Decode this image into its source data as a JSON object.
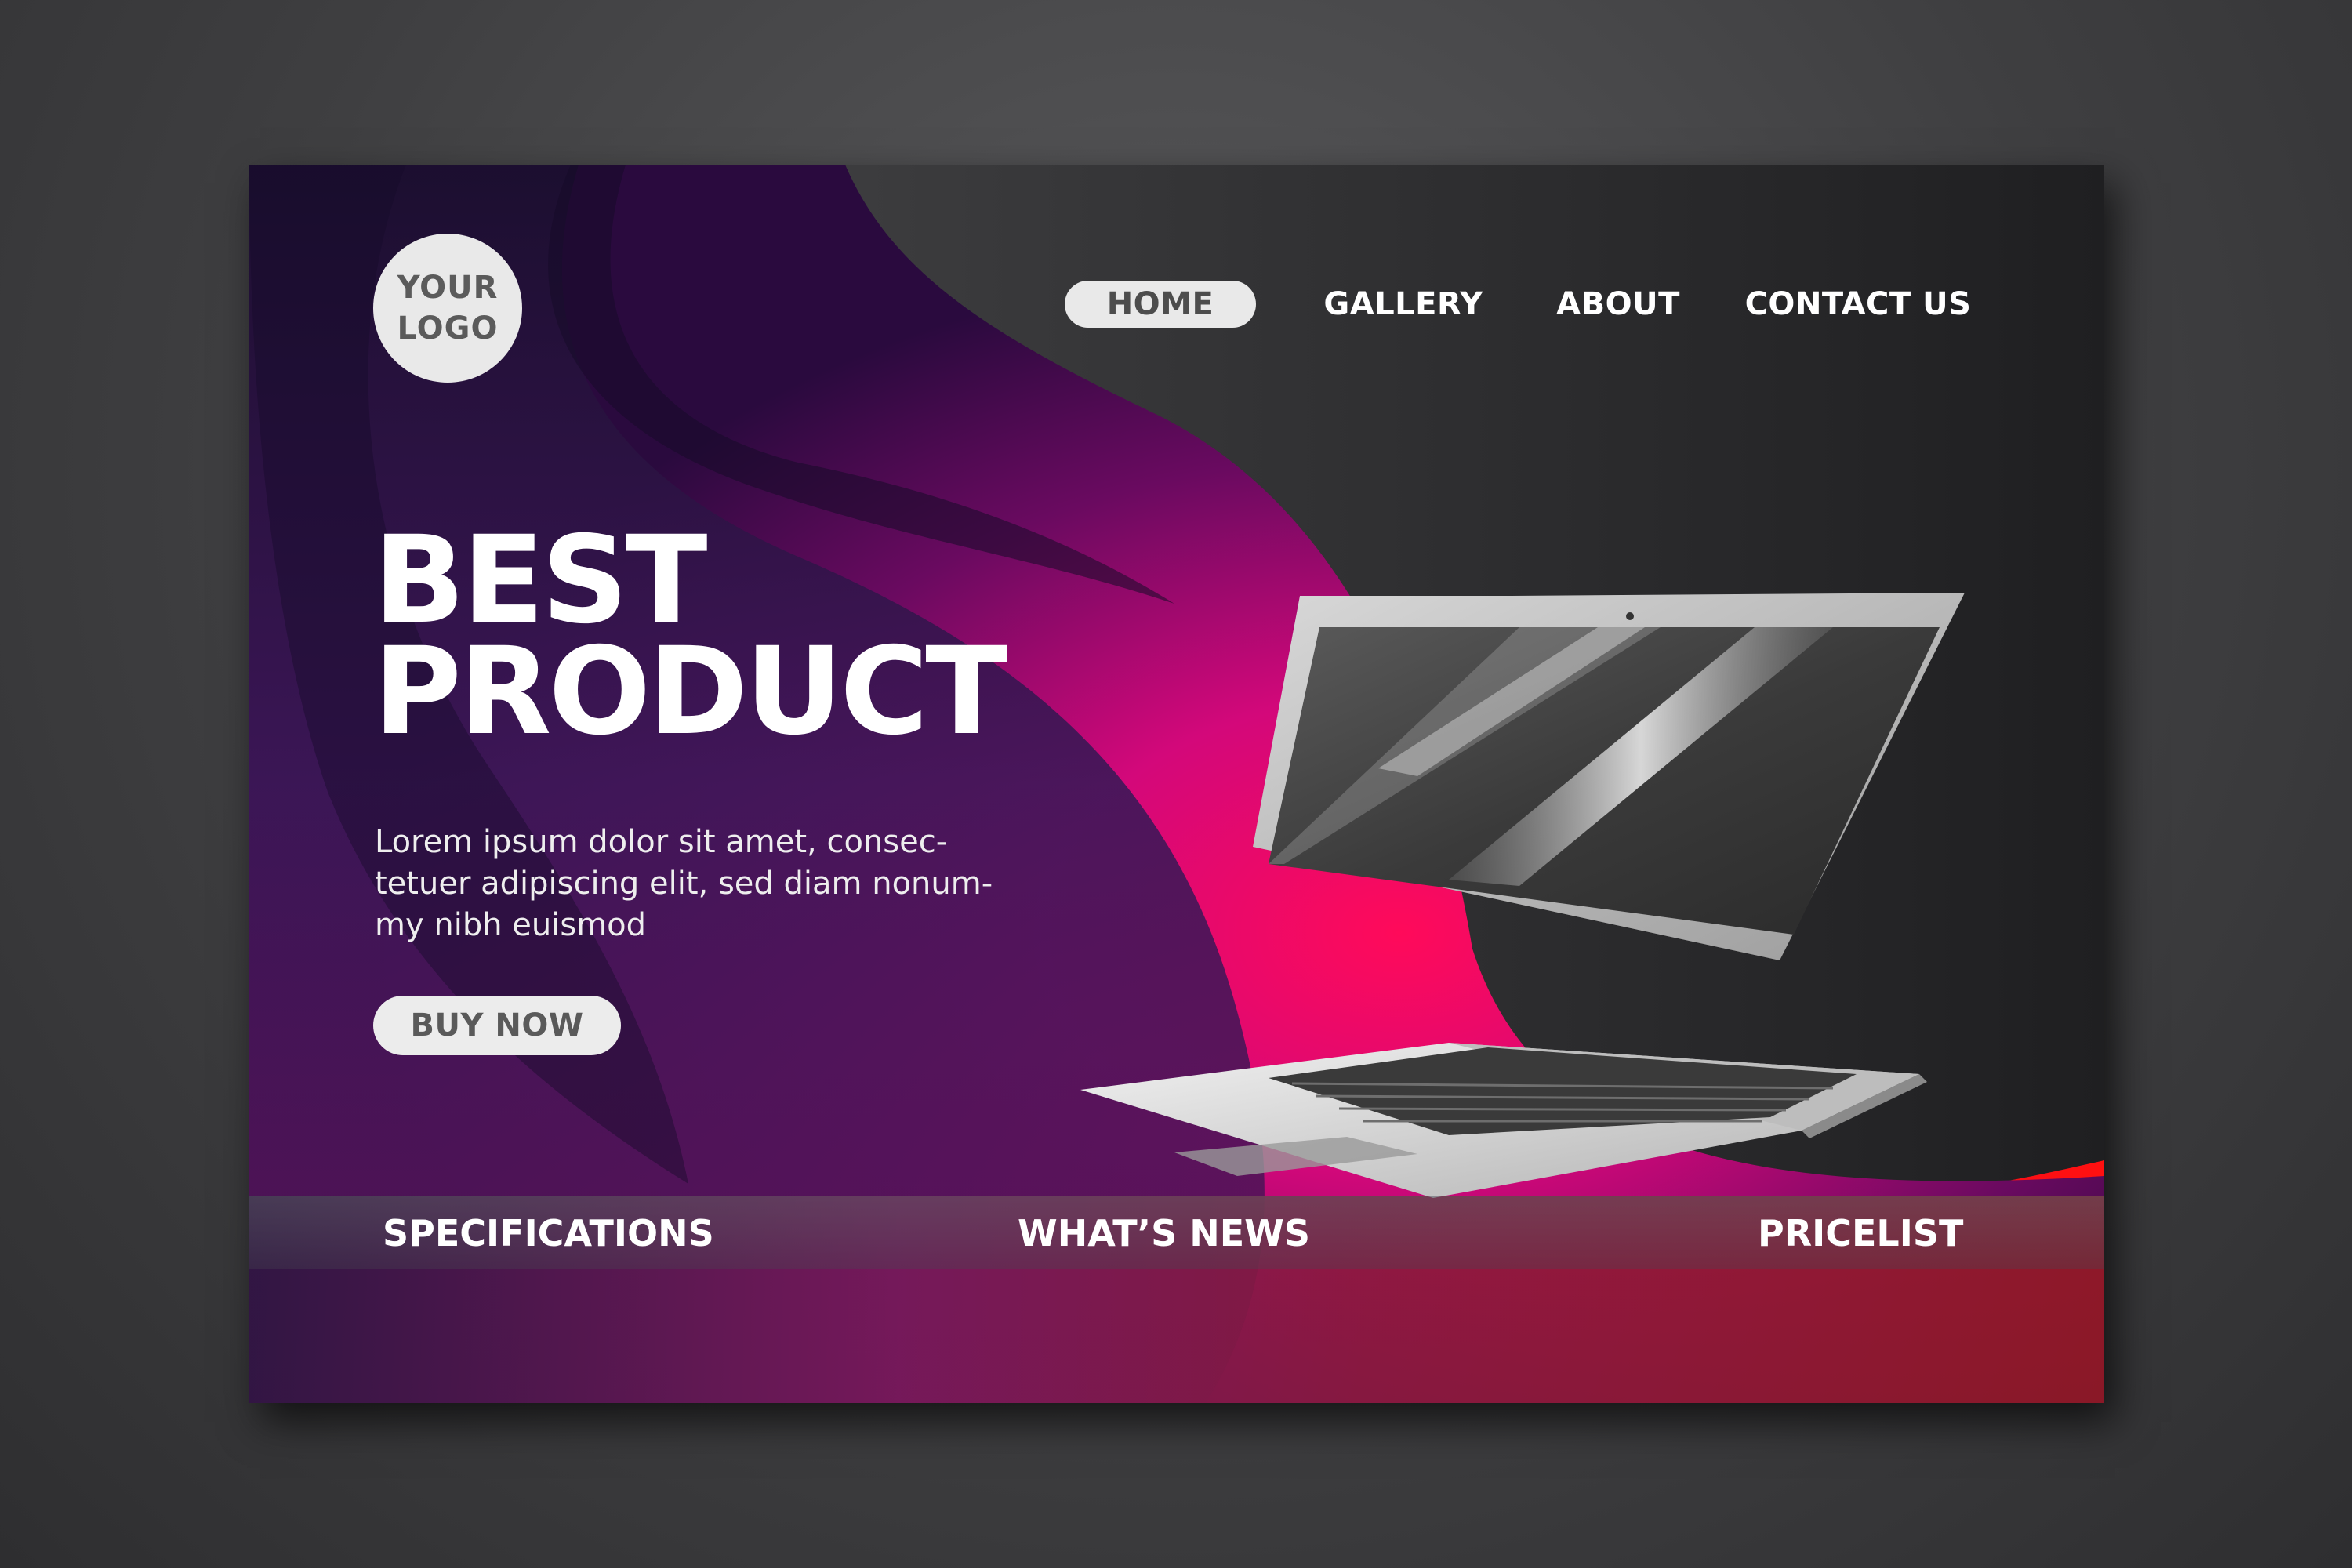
{
  "logo": {
    "line1": "YOUR",
    "line2": "LOGO"
  },
  "nav": {
    "items": [
      {
        "label": "HOME",
        "active": true
      },
      {
        "label": "GALLERY",
        "active": false
      },
      {
        "label": "ABOUT",
        "active": false
      },
      {
        "label": "CONTACT US",
        "active": false
      }
    ]
  },
  "hero": {
    "title_line1": "BEST",
    "title_line2": "PRODUCT",
    "body_line1": "Lorem ipsum dolor sit amet, consec-",
    "body_line2": "tetuer adipiscing elit, sed diam nonum-",
    "body_line3": "my nibh euismod",
    "cta_label": "BUY NOW"
  },
  "footer_tabs": {
    "items": [
      {
        "label": "SPECIFICATIONS"
      },
      {
        "label": "WHAT’S NEWS"
      },
      {
        "label": "PRICELIST"
      }
    ]
  },
  "colors": {
    "accent_magenta": "#e0107a",
    "accent_red": "#ff1020",
    "deep_purple": "#3a1258",
    "dark_bg": "#262628",
    "button_bg": "#e9e9e9"
  }
}
